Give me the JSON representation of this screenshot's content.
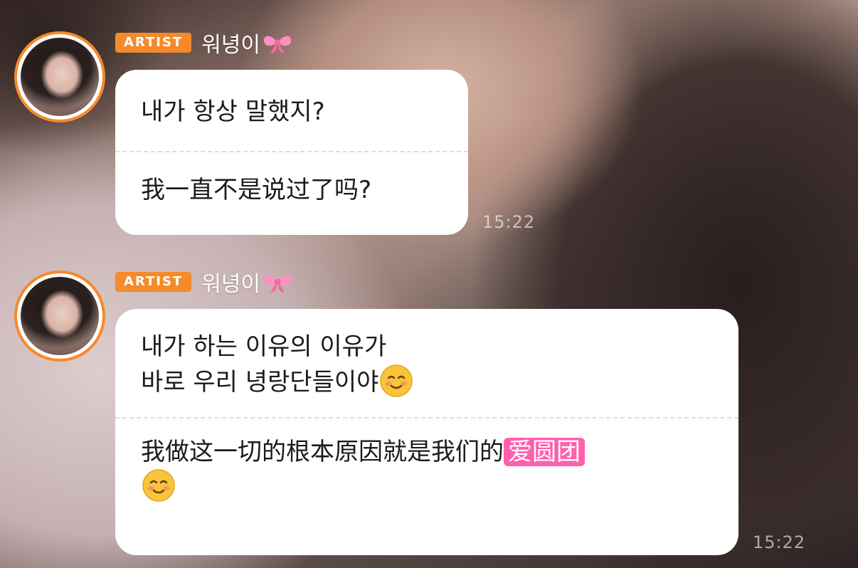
{
  "messages": [
    {
      "badge": "ARTIST",
      "sender": "워녕이",
      "sender_emoji": "ribbon-icon",
      "ko_lines": [
        "내가 항상 말했지?"
      ],
      "zh_lines": [
        "我一直不是说过了吗?"
      ],
      "time": "15:22"
    },
    {
      "badge": "ARTIST",
      "sender": "워녕이",
      "sender_emoji": "ribbon-icon",
      "ko_lines": [
        "내가 하는 이유의 이유가",
        "바로 우리 녕랑단들이야"
      ],
      "zh_line1_text": "我做这一切的根本原因就是我们的",
      "zh_line1_highlight": "爱圆团",
      "time": "15:22"
    }
  ],
  "colors": {
    "badge": "#f58a2a",
    "avatar_ring": "#f58a2a",
    "highlight": "#ff5fae",
    "bubble": "#ffffff"
  }
}
